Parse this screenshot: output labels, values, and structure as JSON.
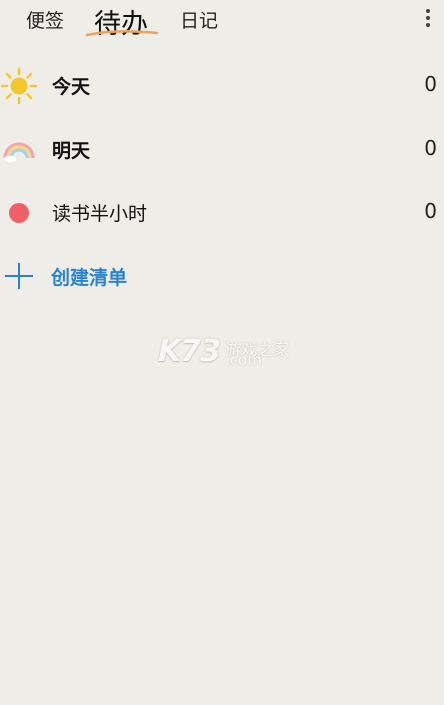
{
  "tabs": [
    {
      "label": "便签",
      "active": false
    },
    {
      "label": "待办",
      "active": true
    },
    {
      "label": "日记",
      "active": false
    }
  ],
  "header": {
    "menu_icon": "more-vertical-icon"
  },
  "lists": [
    {
      "label": "今天",
      "count": "0",
      "icon": "sun-icon"
    },
    {
      "label": "明天",
      "count": "0",
      "icon": "rainbow-icon"
    },
    {
      "label": "读书半小时",
      "count": "0",
      "icon": "red-dot-icon",
      "icon_color": "#ee6169"
    }
  ],
  "create_list": {
    "label": "创建清单",
    "icon": "plus-icon",
    "color": "#2b84c9"
  },
  "watermark": {
    "main": "K73",
    "cn": "游戏之家",
    "domain": ".com"
  },
  "colors": {
    "background": "#efede8",
    "accent": "#2b84c9",
    "underline": "#e9a45a",
    "sun": "#f6c72c",
    "dot": "#ee6169"
  }
}
